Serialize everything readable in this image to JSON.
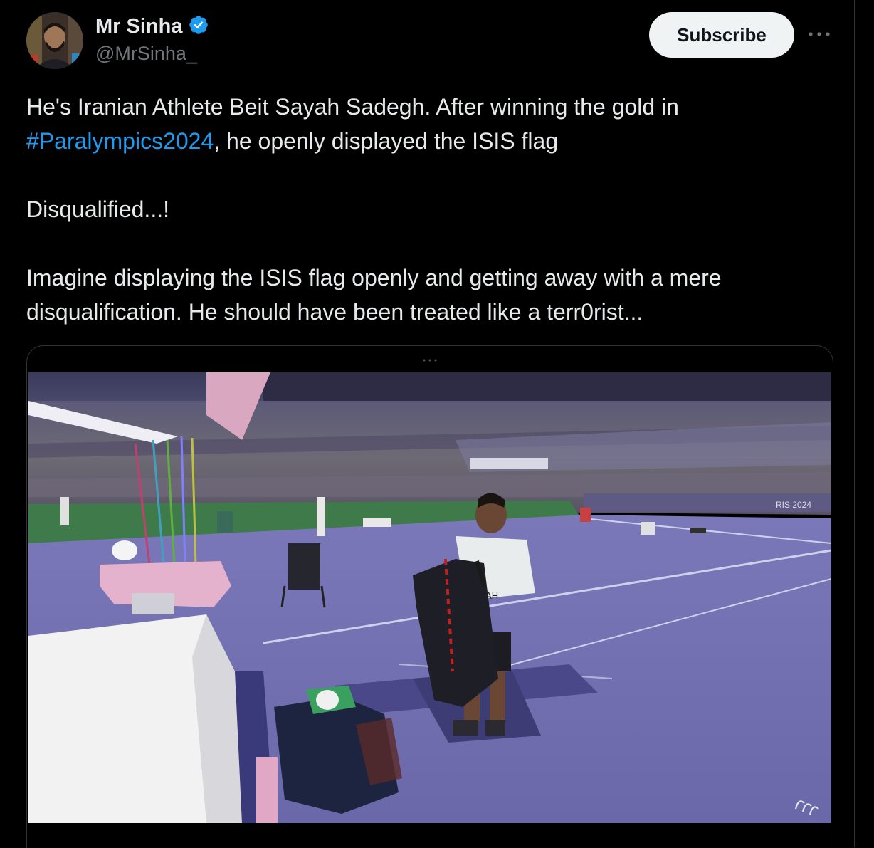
{
  "author": {
    "display_name": "Mr Sinha",
    "handle": "@MrSinha_",
    "verified_icon": "verified-badge-icon",
    "verified_color": "#1d9bf0"
  },
  "actions": {
    "subscribe_label": "Subscribe",
    "more_icon": "more-horizontal-icon"
  },
  "tweet": {
    "line1": "He's Iranian Athlete Beit Sayah Sadegh. After winning the gold in",
    "hashtag": "#Paralympics2024",
    "line2_rest": ", he openly displayed the ISIS flag",
    "line3": "Disqualified...!",
    "line4": "Imagine displaying the ISIS flag openly and getting away with a mere disqualification. He should have been treated like a terr0rist..."
  },
  "media": {
    "type": "video",
    "watermark_icon": "paralympics-agitos-icon",
    "scoreboard_text": "RIS 2024",
    "jersey_text": "SAYAH"
  },
  "colors": {
    "background": "#000000",
    "text": "#e7e9ea",
    "muted": "#71767b",
    "link": "#1d9bf0",
    "border": "#2f3336"
  }
}
